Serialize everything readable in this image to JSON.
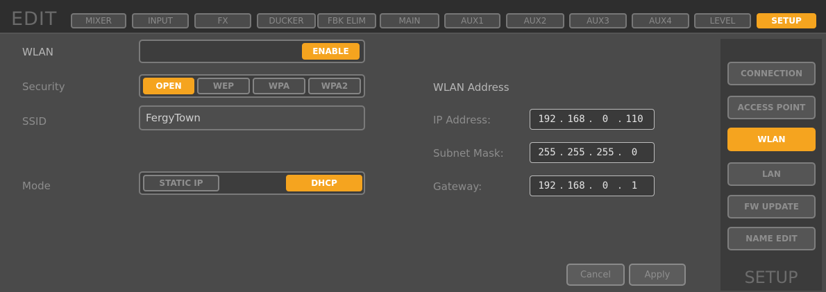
{
  "header": {
    "title": "EDIT",
    "tabs": [
      {
        "label": "MIXER",
        "active": false
      },
      {
        "label": "INPUT",
        "active": false
      },
      {
        "label": "FX",
        "active": false
      },
      {
        "label": "DUCKER",
        "active": false
      },
      {
        "label": "FBK ELIM",
        "active": false
      },
      {
        "label": "MAIN",
        "active": false
      },
      {
        "label": "AUX1",
        "active": false
      },
      {
        "label": "AUX2",
        "active": false
      },
      {
        "label": "AUX3",
        "active": false
      },
      {
        "label": "AUX4",
        "active": false
      },
      {
        "label": "LEVEL",
        "active": false
      },
      {
        "label": "SETUP",
        "active": true
      }
    ]
  },
  "wlan": {
    "label": "WLAN",
    "enable_label": "ENABLE",
    "enabled": true
  },
  "security": {
    "label": "Security",
    "options": [
      "OPEN",
      "WEP",
      "WPA",
      "WPA2"
    ],
    "selected": "OPEN"
  },
  "ssid": {
    "label": "SSID",
    "value": "FergyTown"
  },
  "mode": {
    "label": "Mode",
    "options": [
      "STATIC IP",
      "DHCP"
    ],
    "selected": "DHCP"
  },
  "address": {
    "section_title": "WLAN Address",
    "ip_label": "IP Address:",
    "ip": [
      "192",
      "168",
      "0",
      "110"
    ],
    "subnet_label": "Subnet Mask:",
    "subnet": [
      "255",
      "255",
      "255",
      "0"
    ],
    "gateway_label": "Gateway:",
    "gateway": [
      "192",
      "168",
      "0",
      "1"
    ]
  },
  "actions": {
    "cancel": "Cancel",
    "apply": "Apply"
  },
  "sidebar": {
    "items": [
      {
        "label": "CONNECTION",
        "active": false
      },
      {
        "label": "ACCESS POINT",
        "active": false
      },
      {
        "label": "WLAN",
        "active": true
      },
      {
        "label": "LAN",
        "active": false
      },
      {
        "label": "FW UPDATE",
        "active": false
      },
      {
        "label": "NAME EDIT",
        "active": false
      }
    ],
    "title": "SETUP"
  },
  "colors": {
    "accent": "#f5a41f",
    "background": "#4a4a4a",
    "header": "#2e2e2e"
  }
}
